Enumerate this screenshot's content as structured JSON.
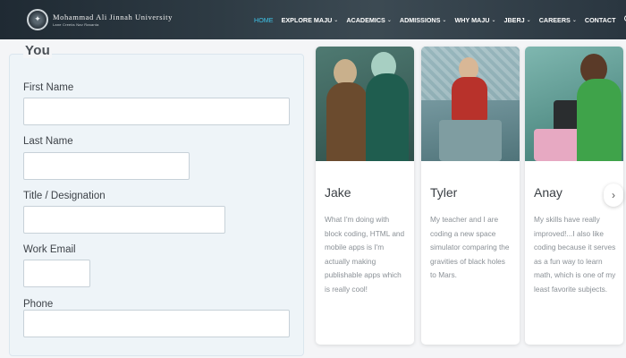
{
  "header": {
    "logo_name": "Mohammad Ali Jinnah University",
    "logo_tagline": "Lane Creeks Nav Rasanta",
    "nav": [
      {
        "label": "HOME",
        "active": true,
        "dropdown": false
      },
      {
        "label": "EXPLORE MAJU",
        "active": false,
        "dropdown": true
      },
      {
        "label": "ACADEMICS",
        "active": false,
        "dropdown": true
      },
      {
        "label": "ADMISSIONS",
        "active": false,
        "dropdown": true
      },
      {
        "label": "WHY MAJU",
        "active": false,
        "dropdown": true
      },
      {
        "label": "JBERJ",
        "active": false,
        "dropdown": true
      },
      {
        "label": "CAREERS",
        "active": false,
        "dropdown": true
      },
      {
        "label": "CONTACT",
        "active": false,
        "dropdown": false
      }
    ],
    "search_icon": "search-icon",
    "accent_color": "#3ec3e8"
  },
  "form": {
    "heading": "You",
    "fields": [
      {
        "label": "First Name",
        "value": "",
        "placeholder": ""
      },
      {
        "label": "Last Name",
        "value": "",
        "placeholder": ""
      },
      {
        "label": "Title / Designation",
        "value": "",
        "placeholder": ""
      },
      {
        "label": "Work Email",
        "value": "",
        "placeholder": ""
      },
      {
        "label": "Phone",
        "value": "",
        "placeholder": ""
      }
    ]
  },
  "testimonials": [
    {
      "name": "Jake",
      "quote": "What I'm doing with block coding, HTML and mobile apps is I'm actually making publishable apps which is really cool!"
    },
    {
      "name": "Tyler",
      "quote": "My teacher and I are coding a new space simulator comparing the gravities of black holes to Mars."
    },
    {
      "name": "Anay",
      "quote": "My skills have really improved!...I also like coding because it serves as a fun way to learn math, which is one of my least favorite subjects."
    }
  ],
  "carousel": {
    "next_icon": "chevron-right-icon",
    "next_glyph": "›"
  }
}
